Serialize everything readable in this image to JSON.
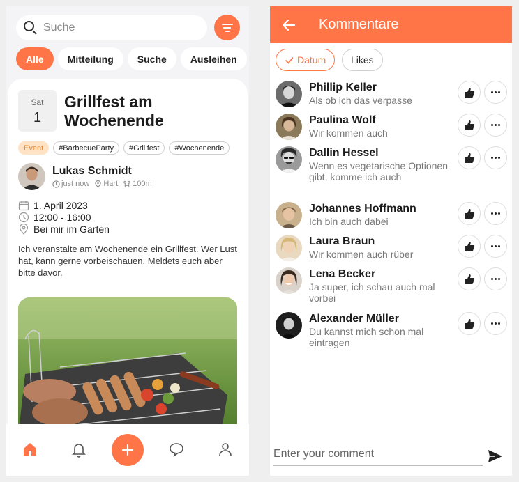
{
  "feed": {
    "search": {
      "placeholder": "Suche"
    },
    "chips": [
      {
        "label": "Alle",
        "active": true
      },
      {
        "label": "Mitteilung",
        "active": false
      },
      {
        "label": "Suche",
        "active": false
      },
      {
        "label": "Ausleihen",
        "active": false
      }
    ],
    "event": {
      "date_day": "Sat",
      "date_num": "1",
      "title": "Grillfest am Wochenende",
      "tags": [
        "Event",
        "#BarbecueParty",
        "#Grillfest",
        "#Wochenende"
      ],
      "author": {
        "name": "Lukas Schmidt",
        "time": "just now",
        "location": "Hart",
        "distance": "100m"
      },
      "date": "1. April 2023",
      "time_range": "12:00 - 16:00",
      "place": "Bei mir im Garten",
      "description": "Ich veranstalte am Wochenende ein Grillfest. Wer Lust hat, kann gerne vorbeischauen. Meldets euch aber bitte davor."
    },
    "nav": [
      {
        "icon": "home-icon",
        "active": true
      },
      {
        "icon": "bell-icon",
        "active": false
      },
      {
        "icon": "add-icon",
        "active": false
      },
      {
        "icon": "chat-icon",
        "active": false
      },
      {
        "icon": "profile-icon",
        "active": false
      }
    ]
  },
  "comments_screen": {
    "title": "Kommentare",
    "sort": [
      {
        "label": "Datum",
        "active": true
      },
      {
        "label": "Likes",
        "active": false
      }
    ],
    "comments": [
      {
        "name": "Phillip Keller",
        "text": "Als ob ich das verpasse"
      },
      {
        "name": "Paulina Wolf",
        "text": "Wir kommen auch"
      },
      {
        "name": "Dallin Hessel",
        "text": "Wenn es vegetarische Optionen gibt, komme ich auch"
      },
      {
        "name": "Johannes Hoffmann",
        "text": "Ich bin auch dabei"
      },
      {
        "name": "Laura Braun",
        "text": "Wir kommen auch rüber"
      },
      {
        "name": "Lena Becker",
        "text": "Ja super, ich schau auch mal vorbei"
      },
      {
        "name": "Alexander Müller",
        "text": "Du kannst mich schon mal eintragen"
      }
    ],
    "input_placeholder": "Enter your comment"
  },
  "colors": {
    "accent": "#ff7547",
    "event_tag_bg": "#ffe3c4",
    "event_tag_text": "#e88a3a"
  }
}
